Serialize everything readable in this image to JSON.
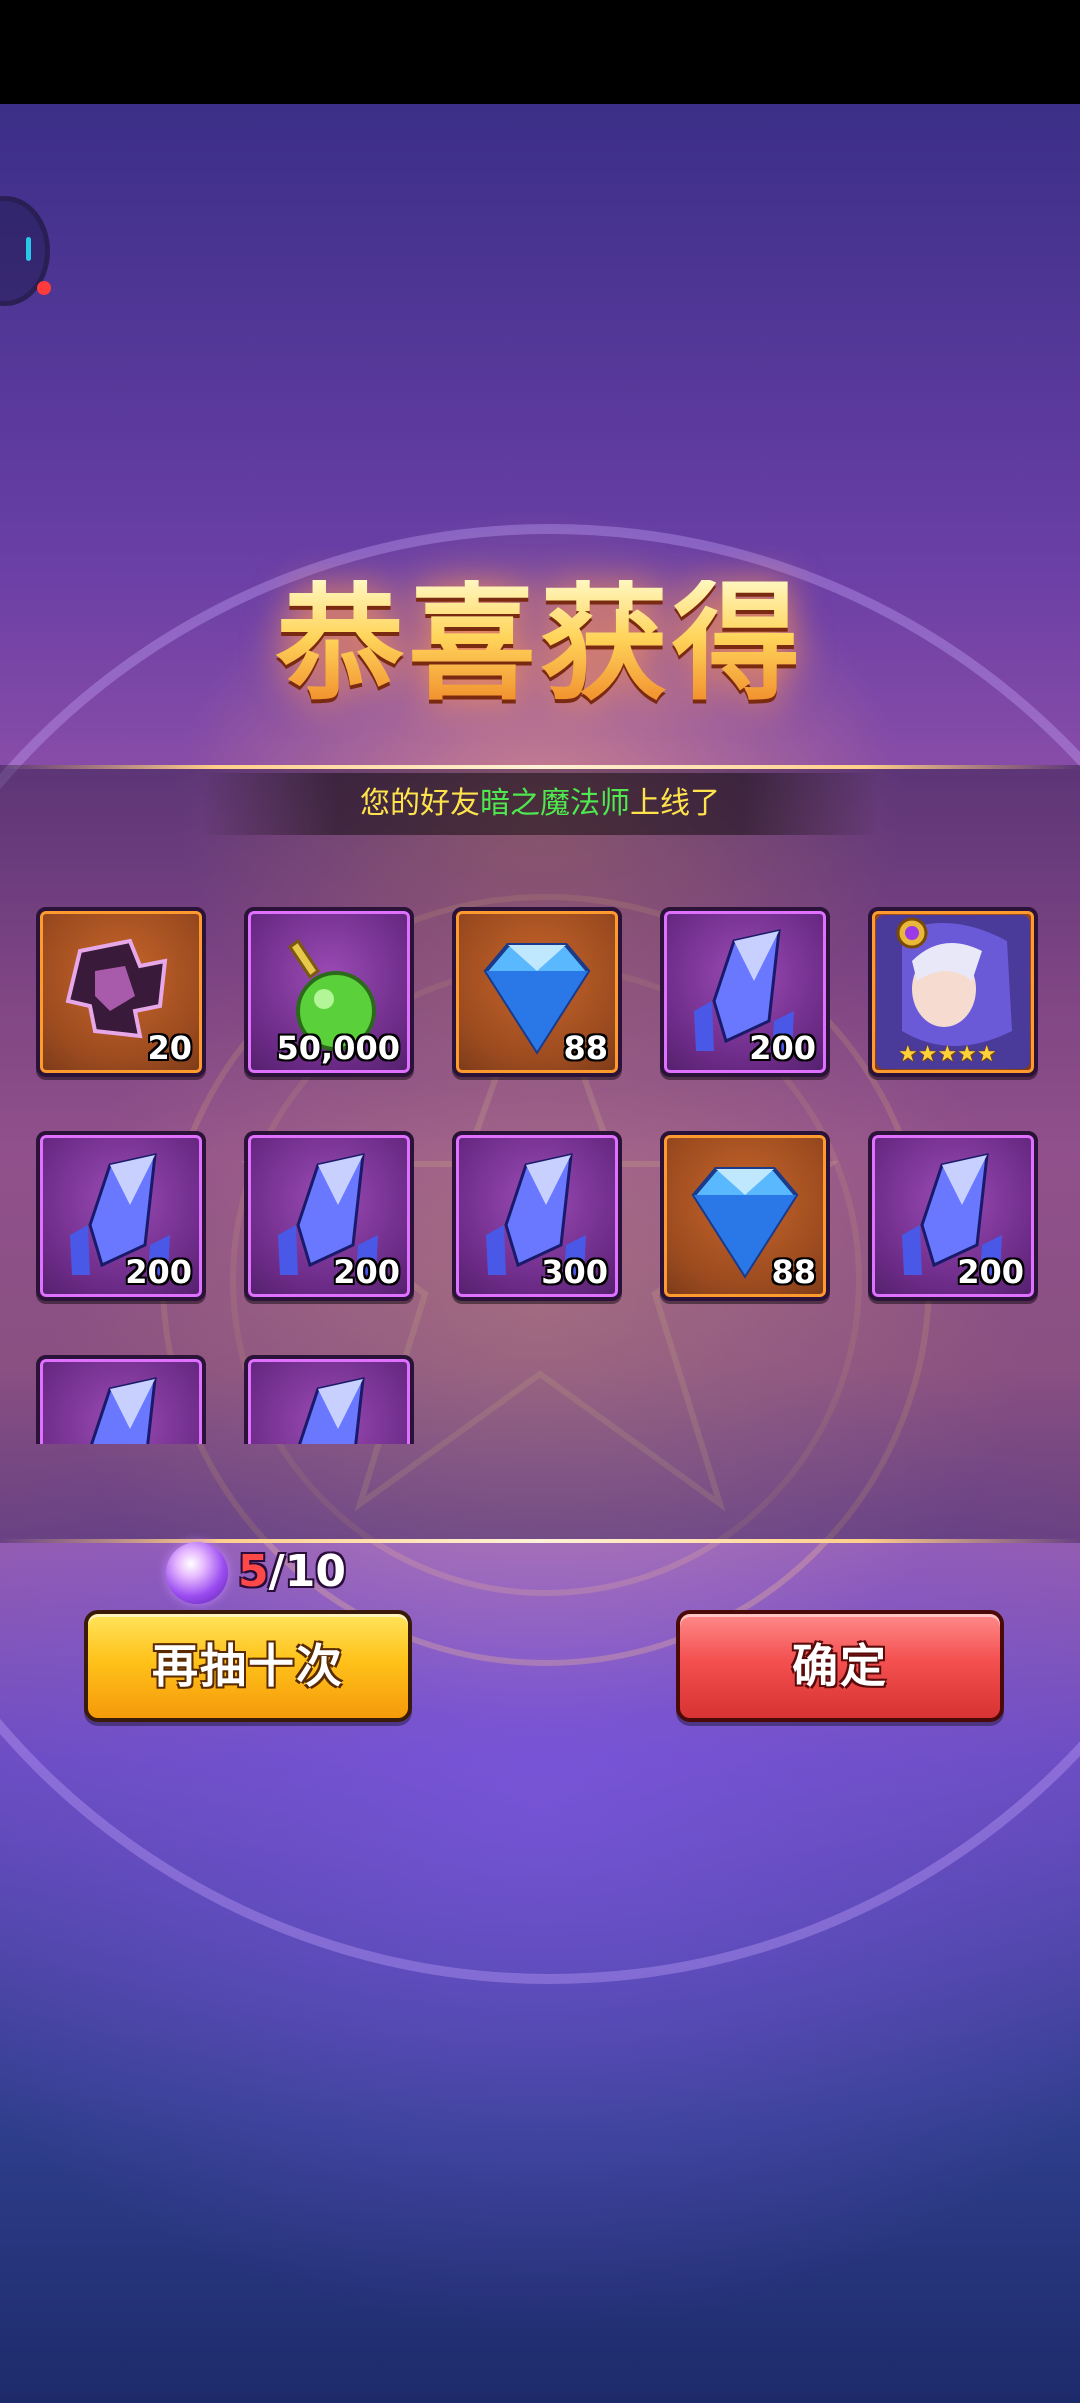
{
  "title": "恭喜获得",
  "notice": {
    "prefix": "您的好友",
    "friend_name": "暗之魔法师",
    "suffix": "上线了"
  },
  "rewards": [
    {
      "icon": "puzzle-shard-icon",
      "count": "20",
      "frame": "orange"
    },
    {
      "icon": "green-potion-icon",
      "count": "50,000",
      "frame": "purple"
    },
    {
      "icon": "blue-diamond-icon",
      "count": "88",
      "frame": "orange"
    },
    {
      "icon": "blue-crystal-icon",
      "count": "200",
      "frame": "purple"
    },
    {
      "icon": "hero-portrait-icon",
      "stars": "★★★★★",
      "frame": "orange"
    },
    {
      "icon": "blue-crystal-icon",
      "count": "200",
      "frame": "purple"
    },
    {
      "icon": "blue-crystal-icon",
      "count": "200",
      "frame": "purple"
    },
    {
      "icon": "blue-crystal-icon",
      "count": "300",
      "frame": "purple"
    },
    {
      "icon": "blue-diamond-icon",
      "count": "88",
      "frame": "orange"
    },
    {
      "icon": "blue-crystal-icon",
      "count": "200",
      "frame": "purple"
    },
    {
      "icon": "blue-crystal-icon",
      "frame": "purple"
    },
    {
      "icon": "blue-crystal-icon",
      "frame": "purple"
    }
  ],
  "draw_counter": {
    "icon": "magic-orb-icon",
    "current": "5",
    "separator": "/",
    "total": "10"
  },
  "buttons": {
    "redraw_label": "再抽十次",
    "confirm_label": "确定"
  },
  "colors": {
    "notice_text": "#ffe34d",
    "friend_name": "#4fe84f",
    "redraw_button": "#ffc21a",
    "confirm_button": "#f45050",
    "counter_current": "#ff4848"
  }
}
